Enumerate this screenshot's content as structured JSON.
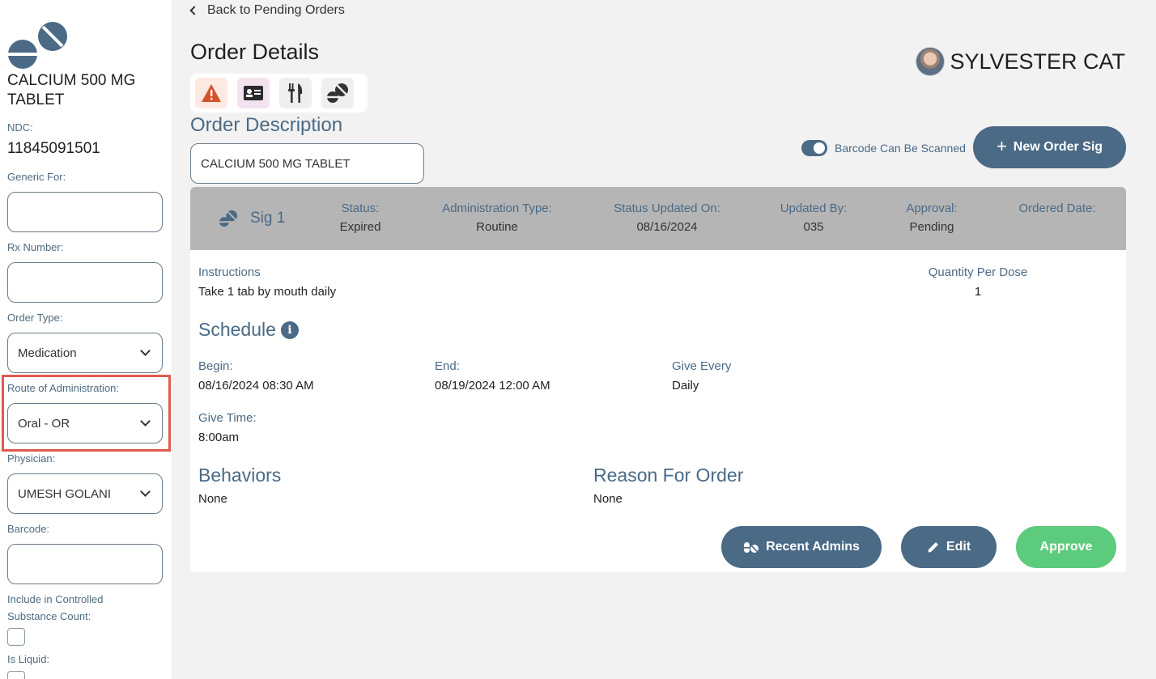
{
  "sidebar": {
    "drug_name": "CALCIUM 500 MG TABLET",
    "ndc_label": "NDC:",
    "ndc_value": "11845091501",
    "generic_for_label": "Generic For:",
    "generic_for_value": "",
    "rx_number_label": "Rx Number:",
    "rx_number_value": "",
    "order_type_label": "Order Type:",
    "order_type_value": "Medication",
    "route_label": "Route of Administration:",
    "route_value": "Oral - OR",
    "physician_label": "Physician:",
    "physician_value": "UMESH GOLANI",
    "barcode_label": "Barcode:",
    "barcode_value": "",
    "controlled_label_1": "Include in Controlled",
    "controlled_label_2": "Substance Count:",
    "liquid_label": "Is Liquid:"
  },
  "header": {
    "back_link": "Back to Pending Orders",
    "title": "Order Details",
    "patient_name": "SYLVESTER CAT",
    "icons": [
      "warning-icon",
      "id-card-icon",
      "utensils-icon",
      "pills-icon"
    ]
  },
  "order": {
    "description_heading": "Order Description",
    "description_value": "CALCIUM 500 MG TABLET",
    "barcode_toggle_label": "Barcode Can Be Scanned",
    "new_sig_button": "New Order Sig"
  },
  "sig": {
    "title": "Sig 1",
    "columns": [
      {
        "label": "Status:",
        "value": "Expired"
      },
      {
        "label": "Administration Type:",
        "value": "Routine"
      },
      {
        "label": "Status Updated On:",
        "value": "08/16/2024"
      },
      {
        "label": "Updated By:",
        "value": "035"
      },
      {
        "label": "Approval:",
        "value": "Pending"
      },
      {
        "label": "Ordered Date:",
        "value": ""
      }
    ],
    "instructions_label": "Instructions",
    "instructions_value": "Take 1 tab by mouth daily",
    "quantity_label": "Quantity Per Dose",
    "quantity_value": "1",
    "schedule_heading": "Schedule",
    "begin_label": "Begin:",
    "begin_value": "08/16/2024 08:30 AM",
    "end_label": "End:",
    "end_value": "08/19/2024 12:00 AM",
    "give_every_label": "Give Every",
    "give_every_value": "Daily",
    "give_time_label": "Give Time:",
    "give_time_value": "8:00am",
    "behaviors_heading": "Behaviors",
    "behaviors_value": "None",
    "reason_heading": "Reason For Order",
    "reason_value": "None"
  },
  "actions": {
    "recent_admins": "Recent Admins",
    "edit": "Edit",
    "approve": "Approve"
  },
  "colors": {
    "primary": "#4a6a86",
    "approve": "#5dcb7e",
    "highlight": "#e05a4f",
    "warning_icon": "#d5532a"
  }
}
